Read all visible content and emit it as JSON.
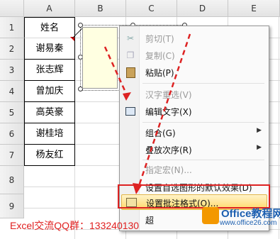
{
  "columns": [
    "A",
    "B",
    "C",
    "D",
    "E"
  ],
  "rows": [
    "1",
    "2",
    "3",
    "4",
    "5",
    "6",
    "7",
    "8",
    "9"
  ],
  "cells_a": [
    "姓名",
    "谢易秦",
    "张志辉",
    "曾加庆",
    "高英豪",
    "谢桂培",
    "杨友红"
  ],
  "context_menu": {
    "items": [
      {
        "label": "剪切(T)",
        "icon": "scissors-icon",
        "disabled": true
      },
      {
        "label": "复制(C)",
        "icon": "copy-icon",
        "disabled": true
      },
      {
        "label": "粘贴(P)",
        "icon": "paste-icon",
        "disabled": false
      },
      {
        "label": "汉字重选(V)",
        "icon": "",
        "disabled": true
      },
      {
        "label": "编辑文字(X)",
        "icon": "edit-text-icon",
        "disabled": false
      },
      {
        "label": "组合(G)",
        "icon": "",
        "disabled": false,
        "submenu": true
      },
      {
        "label": "叠放次序(R)",
        "icon": "",
        "disabled": false,
        "submenu": true
      },
      {
        "label": "指定宏(N)...",
        "icon": "",
        "disabled": true
      },
      {
        "label": "设置自选图形的默认效果(D)",
        "icon": "",
        "disabled": false
      },
      {
        "label": "设置批注格式(O)...",
        "icon": "format-comment-icon",
        "disabled": false,
        "highlighted": true
      }
    ],
    "partial_item": "超"
  },
  "overlay": {
    "bottom_text": "Excel交流QQ群：133240130",
    "watermark_title": "Office教程网",
    "watermark_url": "www.office26.com"
  },
  "colors": {
    "annotation_red": "#d22222",
    "menu_highlight": "#ffd96b",
    "comment_fill": "#ffffe1"
  }
}
